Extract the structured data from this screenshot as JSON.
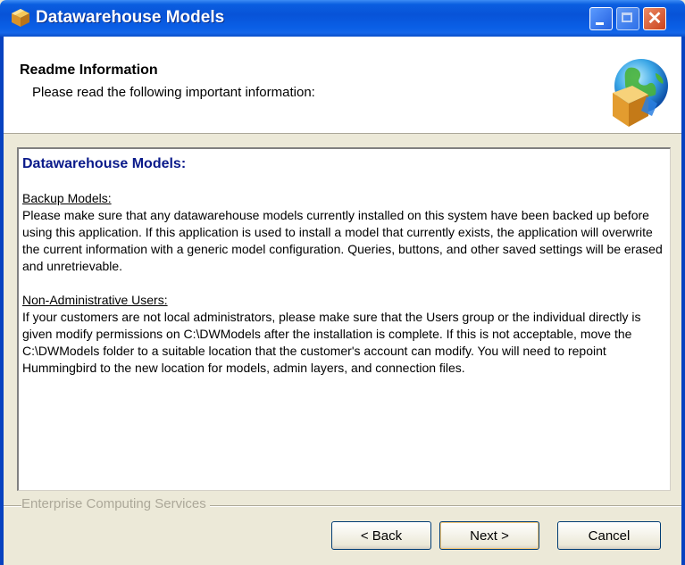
{
  "window": {
    "title": "Datawarehouse Models",
    "icon": "setup-box-icon",
    "controls": [
      "minimize-icon",
      "maximize-icon",
      "close-icon"
    ]
  },
  "header": {
    "title": "Readme Information",
    "subtitle": "Please read the following important information:",
    "graphic": "globe-box-icon"
  },
  "readme": {
    "title": "Datawarehouse Models:",
    "sections": [
      {
        "heading": "Backup Models:",
        "body": "Please make sure that any datawarehouse models currently installed on this system have been backed up before using this application.  If this application is used to install a model that currently exists, the application will overwrite the current information with a generic model configuration.  Queries, buttons, and other saved settings will be erased and unretrievable."
      },
      {
        "heading": "Non-Administrative Users:",
        "body": "If your customers are not local administrators, please make sure that the Users group or the individual directly is given modify permissions on C:\\DWModels after the installation is complete.  If this is not acceptable, move the C:\\DWModels folder to a suitable location that the customer's account can modify.  You will need to repoint Hummingbird to the new location for models, admin layers, and connection files."
      }
    ]
  },
  "footer": {
    "group_label": "Enterprise Computing Services",
    "back_label": "< Back",
    "next_label": "Next >",
    "cancel_label": "Cancel"
  },
  "colors": {
    "titlebar": "#0a5ee0",
    "face": "#ece9d8",
    "readme_title": "#0a1a8a"
  }
}
